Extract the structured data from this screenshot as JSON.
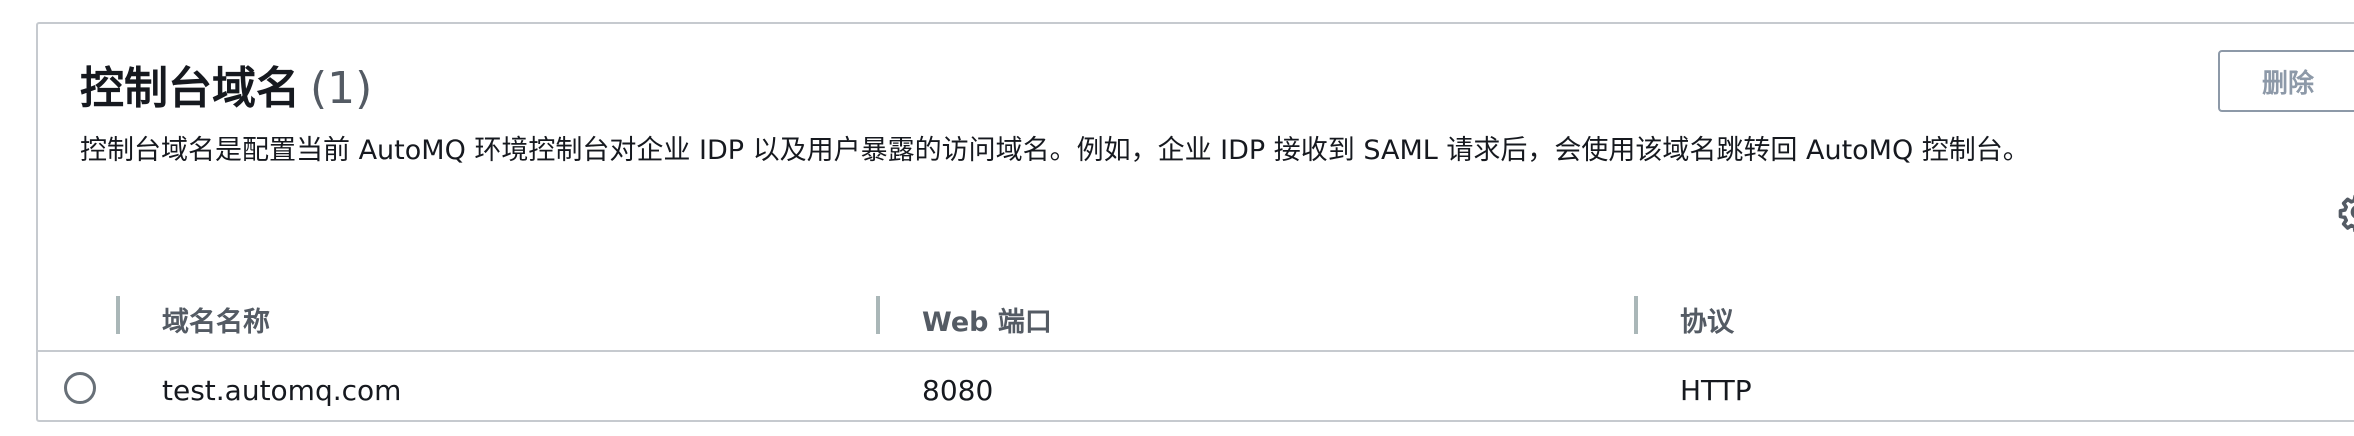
{
  "panel": {
    "title": "控制台域名",
    "count": "(1)",
    "description": "控制台域名是配置当前 AutoMQ 环境控制台对企业 IDP 以及用户暴露的访问域名。例如，企业 IDP 接收到 SAML 请求后，会使用该域名跳转回 AutoMQ 控制台。",
    "delete_label": "删除",
    "settings_icon": "gear-icon"
  },
  "table": {
    "columns": [
      "域名名称",
      "Web 端口",
      "协议"
    ],
    "rows": [
      {
        "selected": false,
        "domain": "test.automq.com",
        "port": "8080",
        "protocol": "HTTP"
      }
    ]
  },
  "colors": {
    "border": "#c6cacf",
    "text": "#16191f",
    "muted": "#545b64",
    "button_disabled": "#8d99a8"
  }
}
